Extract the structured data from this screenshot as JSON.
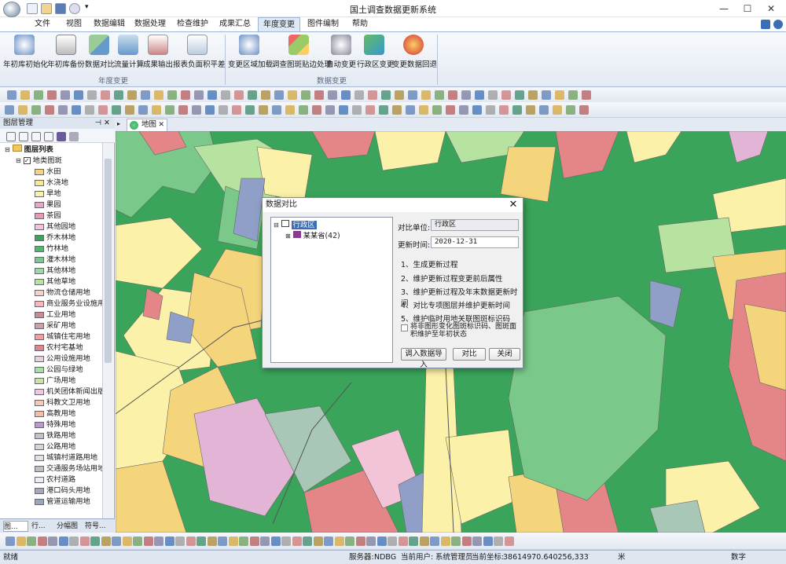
{
  "window": {
    "title": "国土调查数据更新系统",
    "minimize": "—",
    "maximize": "☐",
    "close": "✕"
  },
  "menu": {
    "items": [
      "文件",
      "视图",
      "数据编辑",
      "数据处理",
      "检查维护",
      "成果汇总",
      "年度变更",
      "图件编制",
      "帮助"
    ],
    "active": "年度变更"
  },
  "ribbon": {
    "group1": {
      "title": "年度变更",
      "buttons": [
        "年初库初始化",
        "年初库备份",
        "数据对比",
        "流量计算",
        "成果输出",
        "报表负面积平差"
      ]
    },
    "group2": {
      "title": "数据变更",
      "buttons": [
        "变更区域加载",
        "调查图斑贴边处理",
        "自动变更",
        "行政区变更",
        "变更数据回退"
      ]
    }
  },
  "layer_panel": {
    "title": "图层管理",
    "pin": "⊣ ✕",
    "root": "图层列表",
    "group": "地类图斑",
    "layers": [
      {
        "name": "水田",
        "color": "#f5d57c"
      },
      {
        "name": "水浇地",
        "color": "#f8e890"
      },
      {
        "name": "旱地",
        "color": "#fbf1a8"
      },
      {
        "name": "果园",
        "color": "#e9a6c6"
      },
      {
        "name": "茶园",
        "color": "#e89bb2"
      },
      {
        "name": "其他园地",
        "color": "#f3c3d8"
      },
      {
        "name": "乔木林地",
        "color": "#3aa55a"
      },
      {
        "name": "竹林地",
        "color": "#51b86c"
      },
      {
        "name": "灌木林地",
        "color": "#7bc98a"
      },
      {
        "name": "其他林地",
        "color": "#9fd8a4"
      },
      {
        "name": "其他草地",
        "color": "#b7e3a1"
      },
      {
        "name": "物流仓储用地",
        "color": "#f3d3c3"
      },
      {
        "name": "商业服务业设施用",
        "color": "#f7b8b8"
      },
      {
        "name": "工业用地",
        "color": "#c98c92"
      },
      {
        "name": "采矿用地",
        "color": "#c7a2a8"
      },
      {
        "name": "城镇住宅用地",
        "color": "#f19fa0"
      },
      {
        "name": "农村宅基地",
        "color": "#e48687"
      },
      {
        "name": "公用设施用地",
        "color": "#ead0da"
      },
      {
        "name": "公园与绿地",
        "color": "#a8e0a4"
      },
      {
        "name": "广场用地",
        "color": "#c7e6a6"
      },
      {
        "name": "机关团体新闻出版",
        "color": "#f0c7de"
      },
      {
        "name": "科教文卫用地",
        "color": "#f5c9b7"
      },
      {
        "name": "高教用地",
        "color": "#f5c0a0"
      },
      {
        "name": "特殊用地",
        "color": "#b99ac9"
      },
      {
        "name": "铁路用地",
        "color": "#c3c3c3"
      },
      {
        "name": "公路用地",
        "color": "#d6d6d6"
      },
      {
        "name": "城镇村道路用地",
        "color": "#e2e2e2"
      },
      {
        "name": "交通服务场站用地",
        "color": "#bfbfbf"
      },
      {
        "name": "农村道路",
        "color": "#eeeeee"
      },
      {
        "name": "港口码头用地",
        "color": "#a8a8b8"
      },
      {
        "name": "管道运输用地",
        "color": "#9aa7b5"
      }
    ],
    "tabs": [
      "图...",
      "行...",
      "分幅图",
      "符号..."
    ]
  },
  "map": {
    "tab": "地图"
  },
  "dialog": {
    "title": "数据对比",
    "close": "✕",
    "tree_root": "行政区",
    "tree_child": "某某省(42)",
    "unit_label": "对比单位:",
    "unit_value": "行政区",
    "time_label": "更新时间:",
    "time_value": "2020-12-31",
    "steps": [
      "1、生成更新过程",
      "2、维护更新过程变更前后属性",
      "3、维护更新过程及年末数据更新时间",
      "4、对比专项图层并维护更新时间",
      "5、维护临时用地关联图斑标识码"
    ],
    "checkbox": "将非图形变化图斑标识码、图斑面积维护至年初状态",
    "buttons": {
      "import": "调入数据导入",
      "compare": "对比",
      "close": "关闭"
    }
  },
  "status": {
    "ready": "就绪",
    "server_label": "服务器:",
    "server": "NDBG",
    "user_label": "当前用户:",
    "user": "系统管理员",
    "coord_label": "当前坐标:",
    "coord": "38614970.640256,3337244",
    "unit": "米",
    "mode": "数字"
  }
}
